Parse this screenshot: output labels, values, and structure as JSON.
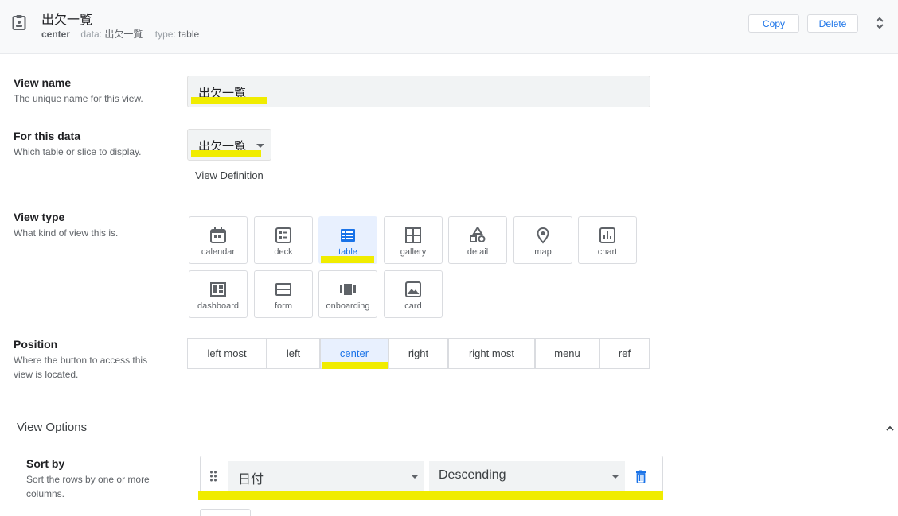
{
  "header": {
    "title": "出欠一覧",
    "position_value": "center",
    "data_label": "data:",
    "data_value": "出欠一覧",
    "type_label": "type:",
    "type_value": "table",
    "copy_label": "Copy",
    "delete_label": "Delete"
  },
  "view_name": {
    "label": "View name",
    "description": "The unique name for this view.",
    "value": "出欠一覧"
  },
  "for_this_data": {
    "label": "For this data",
    "description": "Which table or slice to display.",
    "value": "出欠一覧",
    "link": "View Definition"
  },
  "view_type": {
    "label": "View type",
    "description": "What kind of view this is.",
    "selected": "table",
    "options": [
      "calendar",
      "deck",
      "table",
      "gallery",
      "detail",
      "map",
      "chart",
      "dashboard",
      "form",
      "onboarding",
      "card"
    ]
  },
  "position": {
    "label": "Position",
    "description_line1": "Where the button to access this",
    "description_line2": "view is located.",
    "selected": "center",
    "options": [
      "left most",
      "left",
      "center",
      "right",
      "right most",
      "menu",
      "ref"
    ]
  },
  "view_options": {
    "title": "View Options",
    "sort_by": {
      "label": "Sort by",
      "description_line1": "Sort the rows by one or more",
      "description_line2": "columns.",
      "column": "日付",
      "direction": "Descending"
    }
  },
  "colors": {
    "accent": "#1a73e8",
    "highlight": "#f0ec00",
    "selected_bg": "#e8f0fe"
  }
}
